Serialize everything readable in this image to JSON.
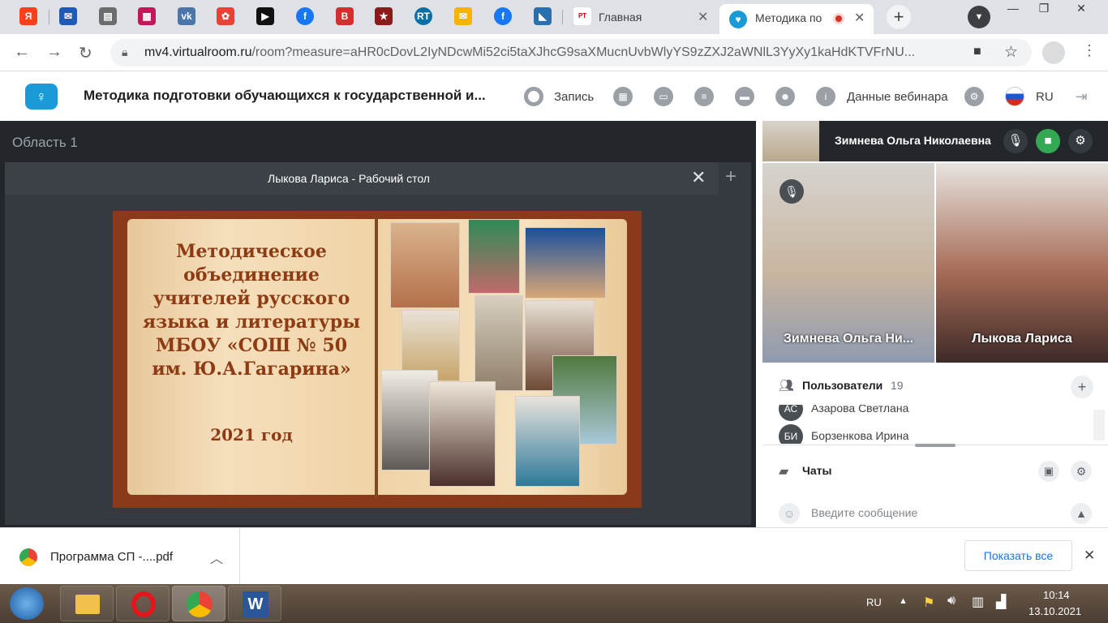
{
  "browser": {
    "tabs": [
      {
        "label": "Главная",
        "icon": "rostelecom-icon"
      },
      {
        "label": "Методика по",
        "icon": "virtualroom-icon"
      }
    ],
    "address": {
      "host": "mv4.virtualroom.ru",
      "path": "/room?measure=aHR0cDovL2IyNDcwMi52ci5taXJhcG9saXMucnUvbWlyYS9zZXJ2aWNlL3YyXy1kaHdKTVFrNU..."
    }
  },
  "app": {
    "title": "Методика подготовки обучающихся к государственной и...",
    "record_label": "Запись",
    "webinar_label": "Данные вебинара",
    "lang": "RU"
  },
  "stage": {
    "area_label": "Область 1",
    "panel_title": "Лыкова Лариса - Рабочий стол",
    "book": {
      "text": "Методическое объединение учителей русского языка и литературы МБОУ «СОШ № 50 им. Ю.А.Гагарина»",
      "year": "2021 год"
    }
  },
  "side": {
    "self_name": "Зимнева Ольга Николаевна",
    "videos": [
      {
        "name": "Зимнева Ольга Ни..."
      },
      {
        "name": "Лыкова Лариса"
      }
    ],
    "users": {
      "title": "Пользователи",
      "count": "19",
      "list": [
        {
          "initials": "АС",
          "name": "Азарова Светлана"
        },
        {
          "initials": "БИ",
          "name": "Борзенкова Ирина"
        }
      ]
    },
    "chats": {
      "title": "Чаты",
      "placeholder": "Введите сообщение"
    }
  },
  "downloads": {
    "file": "Программа СП -....pdf",
    "show_all": "Показать все"
  },
  "taskbar": {
    "lang": "RU",
    "time": "10:14",
    "date": "13.10.2021"
  },
  "colors": {
    "stage_bg": "#23272b",
    "panel_bg": "#343a3f",
    "book_title": "#8e3b13",
    "cam_on": "#34a853"
  }
}
